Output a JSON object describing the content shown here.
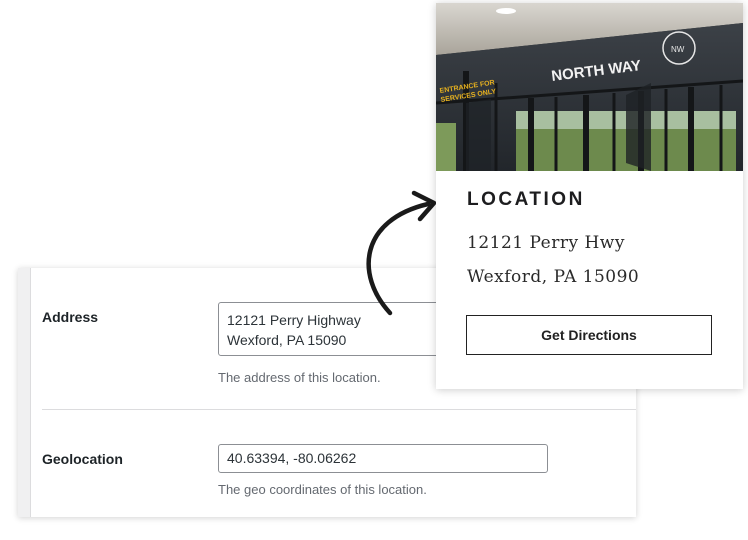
{
  "admin": {
    "address": {
      "label": "Address",
      "value_line1": "12121 Perry Highway",
      "value_line2": "Wexford, PA 15090",
      "description": "The address of this location."
    },
    "geolocation": {
      "label": "Geolocation",
      "value": "40.63394, -80.06262",
      "description": "The geo coordinates of this location."
    }
  },
  "card": {
    "photo": {
      "sign_text": "NORTH WAY",
      "door_sign_line1": "ENTRANCE FOR",
      "door_sign_line2": "SERVICES ONLY",
      "logo_text": "NW"
    },
    "heading": "LOCATION",
    "address_line1": "12121 Perry Hwy",
    "address_line2": "Wexford, PA 15090",
    "button_label": "Get Directions"
  },
  "colors": {
    "field_border": "#8c8f94",
    "description_text": "#646970",
    "sign_yellow": "#e8b21f"
  }
}
